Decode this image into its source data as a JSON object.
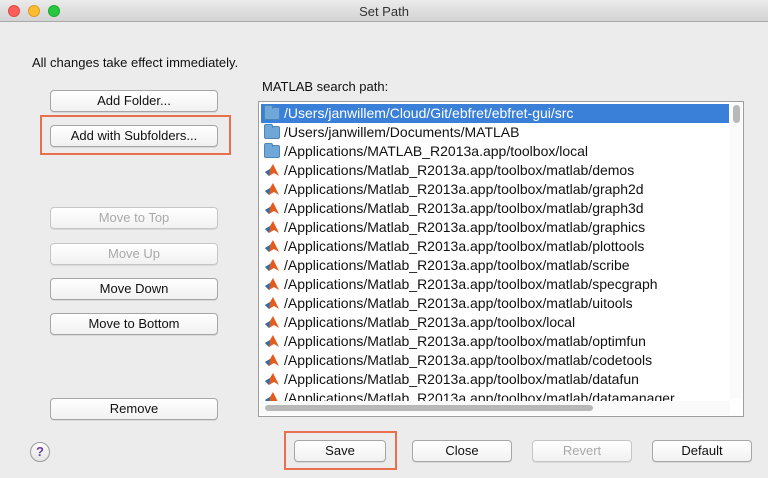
{
  "window": {
    "title": "Set Path"
  },
  "info_text": "All changes take effect immediately.",
  "path_label": "MATLAB search path:",
  "buttons": {
    "add_folder": "Add Folder...",
    "add_with_subfolders": "Add with Subfolders...",
    "move_to_top": "Move to Top",
    "move_up": "Move Up",
    "move_down": "Move Down",
    "move_to_bottom": "Move to Bottom",
    "remove": "Remove",
    "save": "Save",
    "close": "Close",
    "revert": "Revert",
    "default": "Default"
  },
  "help_glyph": "?",
  "paths": [
    {
      "path": "/Users/janwillem/Cloud/Git/ebfret/ebfret-gui/src",
      "icon": "folder-icon",
      "selected": true
    },
    {
      "path": "/Users/janwillem/Documents/MATLAB",
      "icon": "folder-icon"
    },
    {
      "path": "/Applications/MATLAB_R2013a.app/toolbox/local",
      "icon": "folder-icon"
    },
    {
      "path": "/Applications/Matlab_R2013a.app/toolbox/matlab/demos",
      "icon": "matlab-icon"
    },
    {
      "path": "/Applications/Matlab_R2013a.app/toolbox/matlab/graph2d",
      "icon": "matlab-icon"
    },
    {
      "path": "/Applications/Matlab_R2013a.app/toolbox/matlab/graph3d",
      "icon": "matlab-icon"
    },
    {
      "path": "/Applications/Matlab_R2013a.app/toolbox/matlab/graphics",
      "icon": "matlab-icon"
    },
    {
      "path": "/Applications/Matlab_R2013a.app/toolbox/matlab/plottools",
      "icon": "matlab-icon"
    },
    {
      "path": "/Applications/Matlab_R2013a.app/toolbox/matlab/scribe",
      "icon": "matlab-icon"
    },
    {
      "path": "/Applications/Matlab_R2013a.app/toolbox/matlab/specgraph",
      "icon": "matlab-icon"
    },
    {
      "path": "/Applications/Matlab_R2013a.app/toolbox/matlab/uitools",
      "icon": "matlab-icon"
    },
    {
      "path": "/Applications/Matlab_R2013a.app/toolbox/local",
      "icon": "matlab-icon"
    },
    {
      "path": "/Applications/Matlab_R2013a.app/toolbox/matlab/optimfun",
      "icon": "matlab-icon"
    },
    {
      "path": "/Applications/Matlab_R2013a.app/toolbox/matlab/codetools",
      "icon": "matlab-icon"
    },
    {
      "path": "/Applications/Matlab_R2013a.app/toolbox/matlab/datafun",
      "icon": "matlab-icon"
    },
    {
      "path": "/Applications/Matlab_R2013a.app/toolbox/matlab/datamanager",
      "icon": "matlab-icon"
    }
  ],
  "colors": {
    "selection": "#3a80d9",
    "highlight_box": "#e8704f",
    "folder": "#6fa8d8",
    "matlab_logo": "#e35c1e"
  }
}
